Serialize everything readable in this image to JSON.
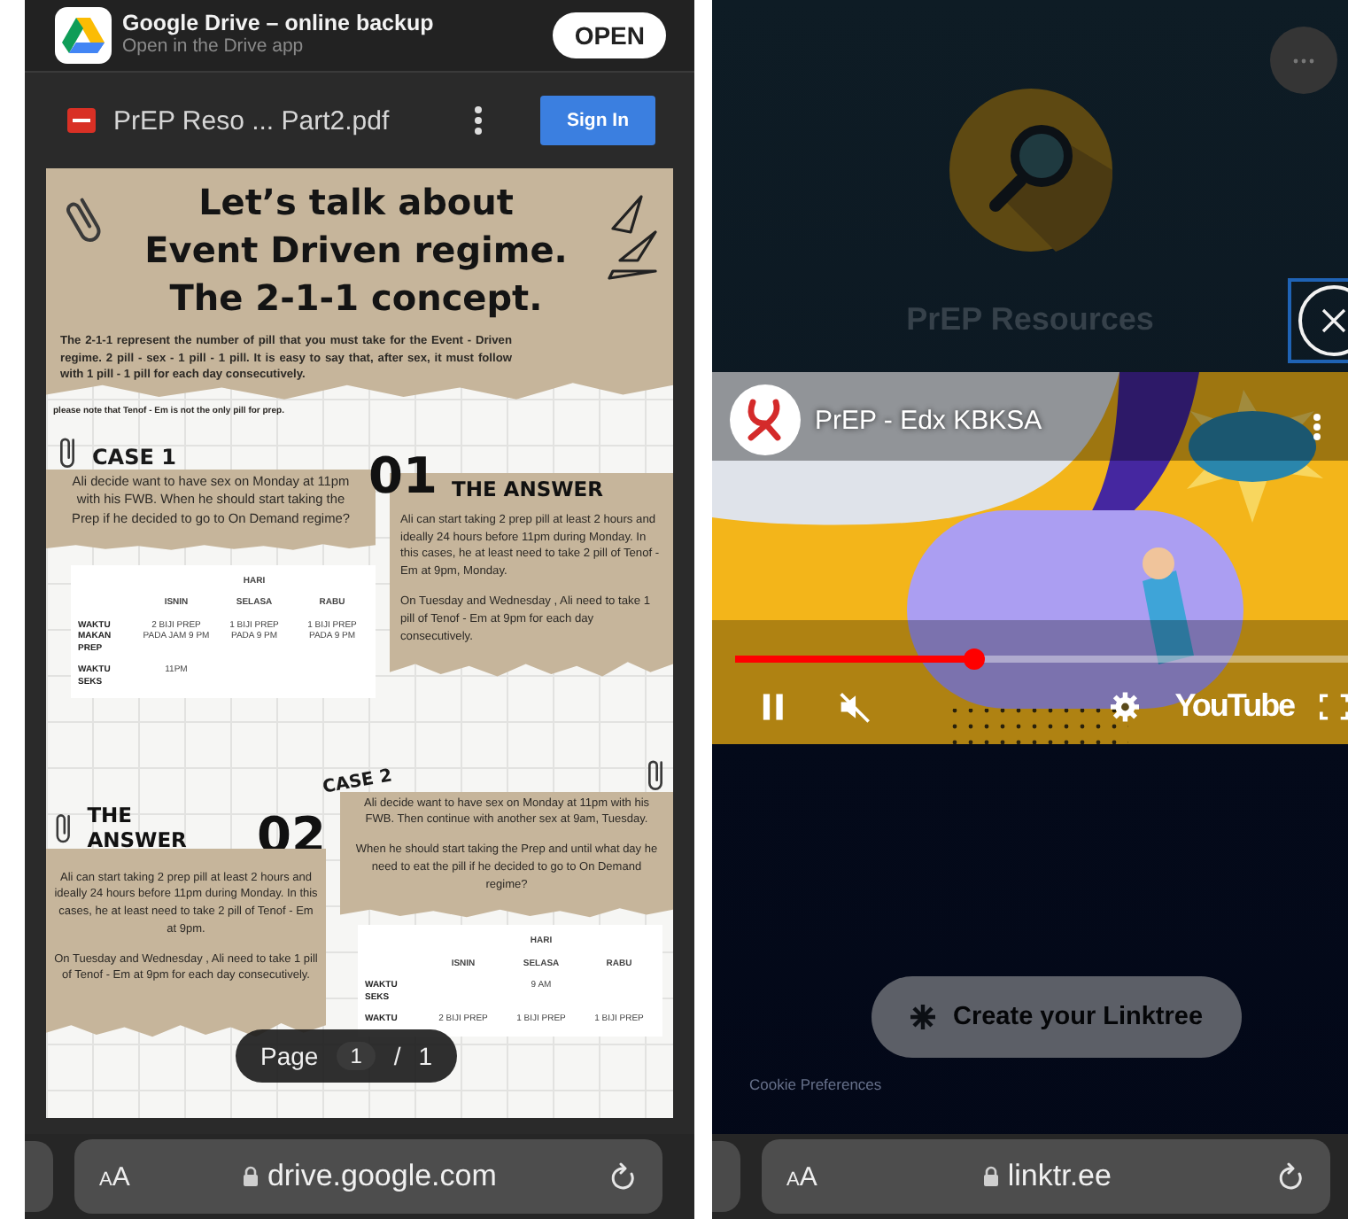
{
  "left_phone": {
    "app_banner": {
      "title": "Google Drive – online backup",
      "subtitle": "Open in the Drive app",
      "button": "OPEN"
    },
    "toolbar": {
      "file_name": "PrEP Reso ... Part2.pdf",
      "button": "Sign In"
    },
    "document": {
      "title_lines": [
        "Let’s talk about",
        "Event Driven regime.",
        "The 2-1-1 concept."
      ],
      "intro": "The 2-1-1 represent the number of pill that you must take for the Event - Driven regime. 2 pill - sex - 1 pill - 1 pill. It is easy to say that, after sex, it must follow with 1 pill - 1 pill for each day consecutively.",
      "note": "please note that Tenof - Em is not the only pill for prep.",
      "cases": [
        {
          "kind": "question-left",
          "label": "CASE 1",
          "number": "01",
          "question": [
            "Ali decide want to have sex on Monday at 11pm with his FWB. When he should start taking the Prep if he decided to go to On Demand regime?"
          ],
          "answer_heading": "THE ANSWER",
          "answer": [
            "Ali can start taking 2 prep pill at least 2 hours and ideally 24 hours before 11pm during Monday. In this cases, he at least need to take 2 pill of Tenof - Em at 9pm, Monday.",
            "On Tuesday and Wednesday , Ali need to take 1 pill of Tenof - Em at 9pm for each day consecutively."
          ],
          "table": {
            "group_header": "HARI",
            "columns": [
              "ISNIN",
              "SELASA",
              "RABU"
            ],
            "rows": [
              {
                "label": "WAKTU MAKAN PREP",
                "cells": [
                  "2 BIJI PREP PADA JAM 9 PM",
                  "1 BIJI PREP PADA 9 PM",
                  "1 BIJI PREP PADA 9 PM"
                ]
              },
              {
                "label": "WAKTU SEKS",
                "cells": [
                  "11PM"
                ]
              }
            ]
          }
        },
        {
          "kind": "question-right",
          "label": "CASE 2",
          "number": "02",
          "question": [
            "Ali decide want to have sex on Monday at 11pm with his FWB. Then continue with another sex at 9am, Tuesday.",
            "When he should start taking the Prep and until what day he need to eat the pill if he decided to go to On Demand regime?"
          ],
          "answer_heading": "THE ANSWER",
          "answer": [
            "Ali can start taking 2 prep pill at least 2 hours and ideally 24 hours before 11pm during Monday. In this cases, he at least need to take 2 pill of Tenof - Em at 9pm.",
            "On Tuesday and Wednesday , Ali need to take 1 pill of Tenof - Em at 9pm for each day consecutively."
          ],
          "table": {
            "group_header": "HARI",
            "columns": [
              "ISNIN",
              "SELASA",
              "RABU"
            ],
            "rows": [
              {
                "label": "WAKTU SEKS",
                "cells": [
                  null,
                  "9 AM"
                ]
              },
              {
                "label": "WAKTU",
                "cells": [
                  "2 BIJI PREP",
                  "1 BIJI PREP",
                  "1 BIJI PREP"
                ]
              }
            ]
          }
        }
      ]
    },
    "page_indicator": {
      "label": "Page",
      "current": "1",
      "separator": "/",
      "total": "1"
    },
    "address_bar": {
      "text_size_button": "AA",
      "url": "drive.google.com"
    }
  },
  "right_phone": {
    "profile_title": "PrEP Resources",
    "video": {
      "title": "PrEP - Edx KBKSA",
      "playing": true,
      "muted": true,
      "progress": {
        "level": 0.39
      },
      "logo": "YouTube"
    },
    "cta_button": "Create your Linktree",
    "footer_link": "Cookie Preferences",
    "address_bar": {
      "text_size_button": "AA",
      "url": "linktr.ee"
    }
  }
}
